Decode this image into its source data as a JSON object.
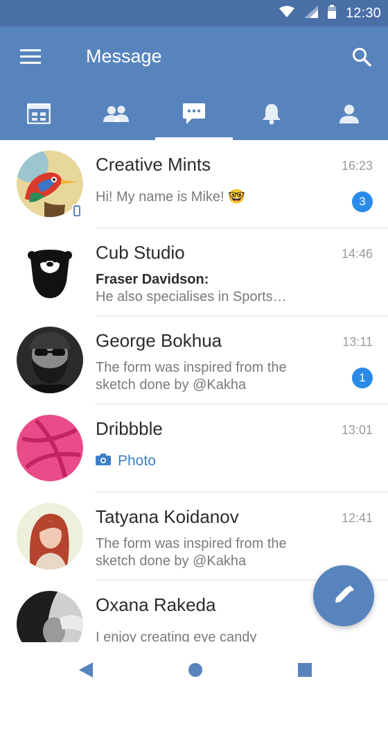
{
  "status_bar": {
    "time": "12:30"
  },
  "app_bar": {
    "title": "Message"
  },
  "tabs": [
    {
      "icon": "calendar-icon",
      "active": false
    },
    {
      "icon": "contacts-icon",
      "active": false
    },
    {
      "icon": "chat-bubble-icon",
      "active": true
    },
    {
      "icon": "bell-icon",
      "active": false
    },
    {
      "icon": "person-icon",
      "active": false
    }
  ],
  "conversations": [
    {
      "name": "Creative Mints",
      "time": "16:23",
      "preview": "Hi! My name is Mike! 🤓",
      "unread": "3",
      "avatar": "bird-painting"
    },
    {
      "name": "Cub Studio",
      "time": "14:46",
      "sender": "Fraser Davidson:",
      "preview": "He also specialises in Sports…",
      "avatar": "bear-logo"
    },
    {
      "name": "George Bokhua",
      "time": "13:11",
      "preview": "The form was inspired from the sketch done by @Kakha",
      "unread": "1",
      "avatar": "bearded-man"
    },
    {
      "name": "Dribbble",
      "time": "13:01",
      "preview": "Photo",
      "avatar": "dribbble-ball"
    },
    {
      "name": "Tatyana Koidanov",
      "time": "12:41",
      "preview": "The form was inspired from the sketch done by @Kakha",
      "avatar": "red-haired-woman"
    },
    {
      "name": "Oxana Rakeda",
      "time": "",
      "preview": "I enjoy creating eye candy",
      "avatar": "dark-haired-woman"
    }
  ],
  "colors": {
    "app_bar": "#5784bd",
    "status_bar": "#4a6ea6",
    "badge": "#2a8ae8",
    "link": "#3f7fc6"
  }
}
